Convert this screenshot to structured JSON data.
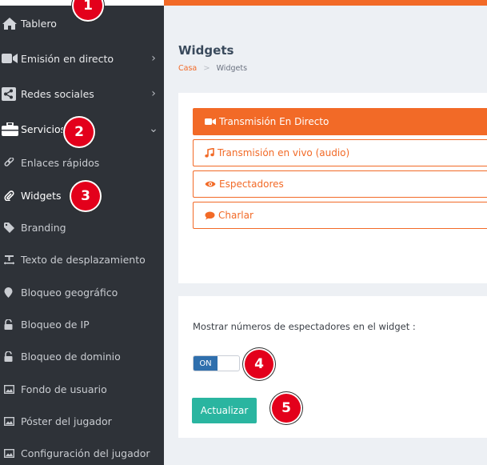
{
  "sidebar": {
    "items": [
      {
        "label": "Tablero",
        "icon": "home-icon"
      },
      {
        "label": "Emisión en directo",
        "icon": "video-camera-icon",
        "chevron": "›"
      },
      {
        "label": "Redes sociales",
        "icon": "share-icon",
        "chevron": "›"
      },
      {
        "label": "Servicios",
        "icon": "briefcase-icon",
        "chevron": "⌄"
      },
      {
        "label": "Enlaces rápidos",
        "icon": "link-icon"
      },
      {
        "label": "Widgets",
        "icon": "paperclip-icon"
      },
      {
        "label": "Branding",
        "icon": "tag-icon"
      },
      {
        "label": "Texto de desplazamiento",
        "icon": "text-scroll-icon"
      },
      {
        "label": "Bloqueo geográfico",
        "icon": "map-pin-icon"
      },
      {
        "label": "Bloqueo de IP",
        "icon": "unlock-icon"
      },
      {
        "label": "Bloqueo de dominio",
        "icon": "unlock-icon"
      },
      {
        "label": "Fondo de usuario",
        "icon": "image-icon"
      },
      {
        "label": "Póster del jugador",
        "icon": "image-icon"
      },
      {
        "label": "Configuración del jugador",
        "icon": "image-icon"
      }
    ]
  },
  "header": {
    "title": "Widgets",
    "breadcrumb": {
      "home": "Casa",
      "separator": ">",
      "current": "Widgets"
    }
  },
  "widget_options": [
    {
      "label": "Transmisión En Directo",
      "icon": "video-camera-icon",
      "active": true
    },
    {
      "label": "Transmisión en vivo (audio)",
      "icon": "music-note-icon",
      "active": false
    },
    {
      "label": "Espectadores",
      "icon": "eye-icon",
      "active": false
    },
    {
      "label": "Charlar",
      "icon": "chat-bubble-icon",
      "active": false
    }
  ],
  "settings": {
    "viewer_count_label": "Mostrar números de espectadores en el widget :",
    "toggle_state": "ON",
    "update_button": "Actualizar"
  },
  "markers": [
    "1",
    "2",
    "3",
    "4",
    "5"
  ],
  "colors": {
    "accent": "#f26a27",
    "sidebar_bg": "#2e3238",
    "toggle_on": "#2f6fad",
    "button": "#2ab5a0",
    "marker": "#e3001b"
  }
}
